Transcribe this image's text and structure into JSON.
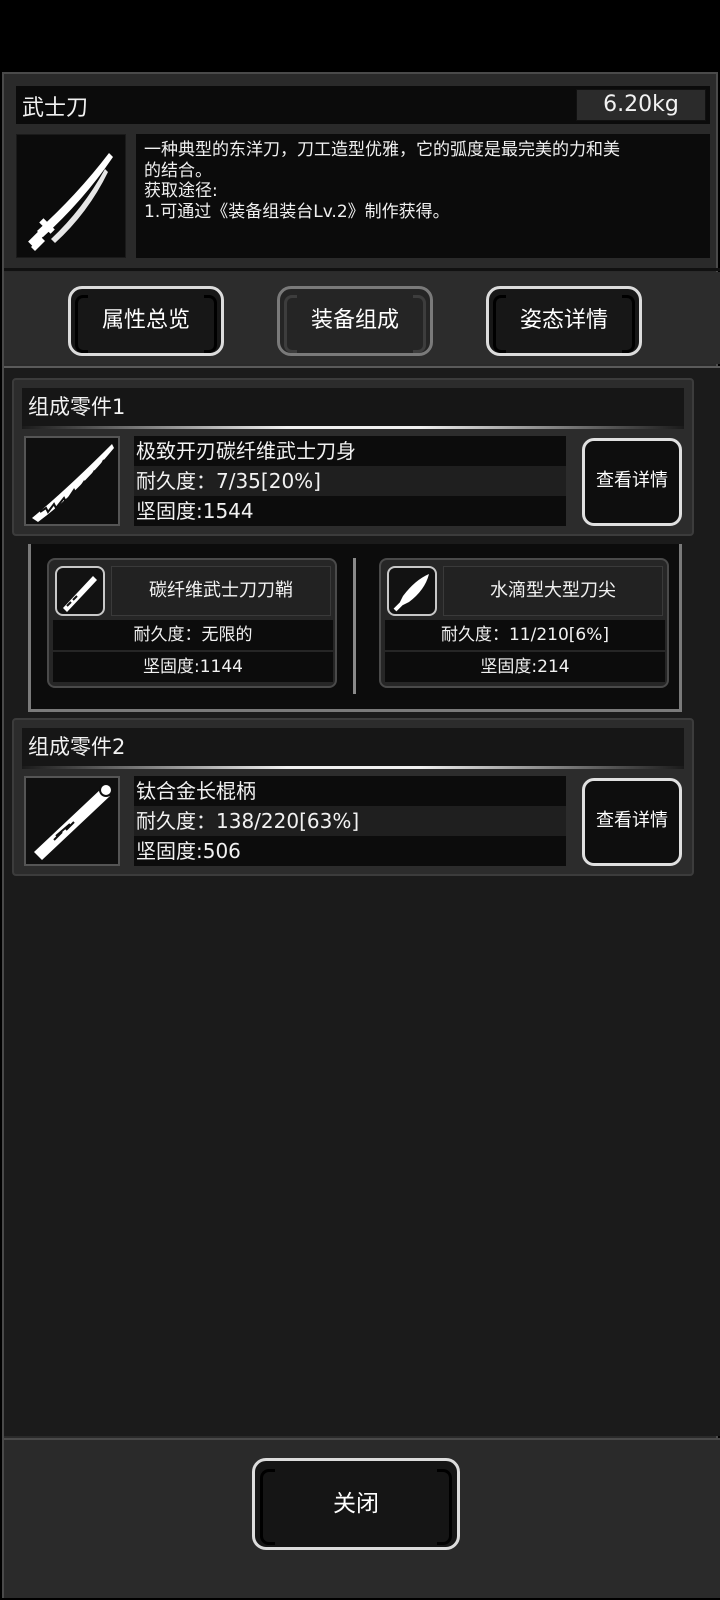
{
  "item": {
    "name": "武士刀",
    "weight": "6.20kg",
    "icon": "katana-icon",
    "description_lines": [
      "一种典型的东洋刀，刀工造型优雅，它的弧度是最完美的力和美",
      "的结合。",
      "获取途径:",
      "1.可通过《装备组装台Lv.2》制作获得。"
    ]
  },
  "tabs": [
    {
      "label": "属性总览",
      "active": false
    },
    {
      "label": "装备组成",
      "active": true
    },
    {
      "label": "姿态详情",
      "active": false
    }
  ],
  "components": [
    {
      "title": "组成零件1",
      "part_name": "极致开刃碳纤维武士刀身",
      "icon": "blade-icon",
      "durability": "耐久度：7/35[20%]",
      "hardness": "坚固度:1544",
      "detail_label": "查看详情"
    },
    {
      "title": "组成零件2",
      "part_name": "钛合金长棍柄",
      "icon": "handle-icon",
      "durability": "耐久度：138/220[63%]",
      "hardness": "坚固度:506",
      "detail_label": "查看详情"
    }
  ],
  "sub_components": [
    {
      "name": "碳纤维武士刀刀鞘",
      "icon": "scabbard-icon",
      "durability": "耐久度：无限的",
      "hardness": "坚固度:1144"
    },
    {
      "name": "水滴型大型刀尖",
      "icon": "blade-tip-icon",
      "durability": "耐久度：11/210[6%]",
      "hardness": "坚固度:214"
    }
  ],
  "footer": {
    "close_label": "关闭"
  },
  "colors": {
    "background": "#2a2a2a",
    "content": "#1b1b1b",
    "dark_cell": "#0c0c0c",
    "text": "#f2f2f2",
    "border_light": "#dcdcdc"
  }
}
